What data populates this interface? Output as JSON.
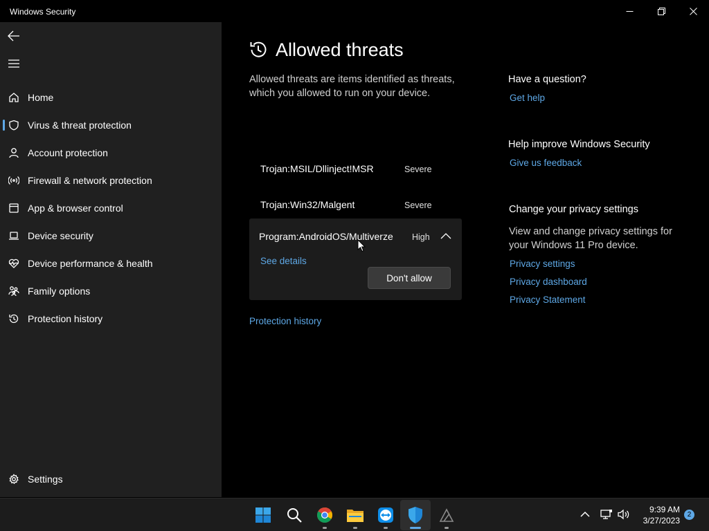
{
  "window": {
    "title": "Windows Security"
  },
  "sidebar": {
    "items": [
      {
        "label": "Home",
        "icon": "home-icon"
      },
      {
        "label": "Virus & threat protection",
        "icon": "shield-icon",
        "active": true
      },
      {
        "label": "Account protection",
        "icon": "person-icon"
      },
      {
        "label": "Firewall & network protection",
        "icon": "wifi-icon"
      },
      {
        "label": "App & browser control",
        "icon": "browser-window-icon"
      },
      {
        "label": "Device security",
        "icon": "laptop-icon"
      },
      {
        "label": "Device performance & health",
        "icon": "heart-pulse-icon"
      },
      {
        "label": "Family options",
        "icon": "family-icon"
      },
      {
        "label": "Protection history",
        "icon": "history-icon"
      }
    ],
    "settings_label": "Settings"
  },
  "main": {
    "title": "Allowed threats",
    "description": "Allowed threats are items identified as threats, which you allowed to run on your device.",
    "threats": [
      {
        "name": "Trojan:MSIL/Dllinject!MSR",
        "severity": "Severe"
      },
      {
        "name": "Trojan:Win32/Malgent",
        "severity": "Severe"
      }
    ],
    "expanded_threat": {
      "name": "Program:AndroidOS/Multiverze",
      "severity": "High",
      "see_details": "See details",
      "button": "Don't allow"
    },
    "protection_history_link": "Protection history"
  },
  "right_panel": {
    "question_heading": "Have a question?",
    "get_help": "Get help",
    "improve_heading": "Help improve Windows Security",
    "feedback": "Give us feedback",
    "privacy_heading": "Change your privacy settings",
    "privacy_text": "View and change privacy settings for your Windows 11 Pro device.",
    "privacy_links": [
      "Privacy settings",
      "Privacy dashboard",
      "Privacy Statement"
    ]
  },
  "taskbar": {
    "time": "9:39 AM",
    "date": "3/27/2023",
    "notification_count": "2"
  },
  "colors": {
    "accent": "#5ea8e6",
    "sidebar_bg": "#202020",
    "main_bg": "#000000"
  }
}
